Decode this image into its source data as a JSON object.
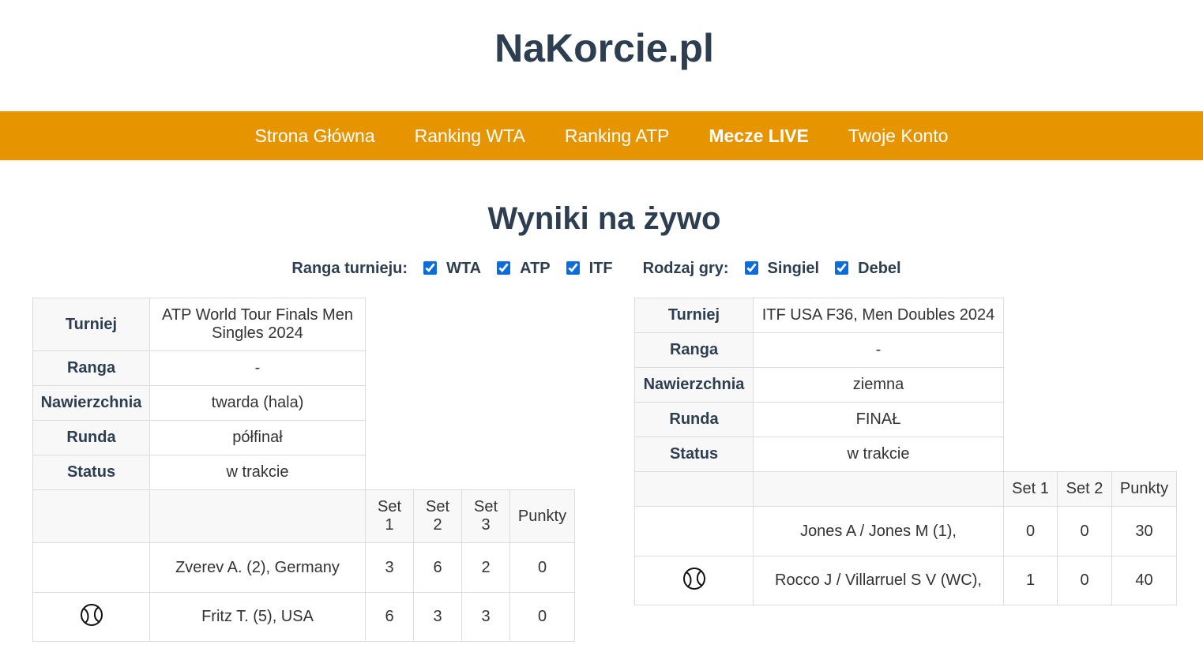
{
  "site": {
    "title": "NaKorcie.pl"
  },
  "nav": {
    "items": [
      {
        "label": "Strona Główna",
        "active": false
      },
      {
        "label": "Ranking WTA",
        "active": false
      },
      {
        "label": "Ranking ATP",
        "active": false
      },
      {
        "label": "Mecze LIVE",
        "active": true
      },
      {
        "label": "Twoje Konto",
        "active": false
      }
    ]
  },
  "page": {
    "heading": "Wyniki na żywo"
  },
  "filters": {
    "tournament_label": "Ranga turnieju:",
    "tournament_options": [
      {
        "label": "WTA",
        "checked": true
      },
      {
        "label": "ATP",
        "checked": true
      },
      {
        "label": "ITF",
        "checked": true
      }
    ],
    "game_label": "Rodzaj gry:",
    "game_options": [
      {
        "label": "Singiel",
        "checked": true
      },
      {
        "label": "Debel",
        "checked": true
      }
    ]
  },
  "labels": {
    "tournament": "Turniej",
    "rank": "Ranga",
    "surface": "Nawierzchnia",
    "round": "Runda",
    "status": "Status",
    "set1": "Set 1",
    "set2": "Set 2",
    "set3": "Set 3",
    "points": "Punkty"
  },
  "matches": [
    {
      "tournament": "ATP World Tour Finals Men Singles 2024",
      "rank": "-",
      "surface": "twarda (hala)",
      "round": "półfinał",
      "status": "w trakcie",
      "players": [
        {
          "name": "Zverev A. (2), Germany",
          "serving": false,
          "sets": [
            "3",
            "6",
            "2"
          ],
          "points": "0"
        },
        {
          "name": "Fritz T. (5), USA",
          "serving": true,
          "sets": [
            "6",
            "3",
            "3"
          ],
          "points": "0"
        }
      ]
    },
    {
      "tournament": "ITF USA F36, Men Doubles 2024",
      "rank": "-",
      "surface": "ziemna",
      "round": "FINAŁ",
      "status": "w trakcie",
      "players": [
        {
          "name": "Jones A / Jones M (1),",
          "serving": false,
          "sets": [
            "0",
            "0"
          ],
          "points": "30"
        },
        {
          "name": "Rocco J / Villarruel S V (WC),",
          "serving": true,
          "sets": [
            "1",
            "0"
          ],
          "points": "40"
        }
      ]
    }
  ],
  "icons": {
    "serving": "tennis-ball-icon"
  },
  "colors": {
    "nav_bg": "#e69500",
    "text": "#2c3e50",
    "checkbox": "#0b6cda"
  }
}
